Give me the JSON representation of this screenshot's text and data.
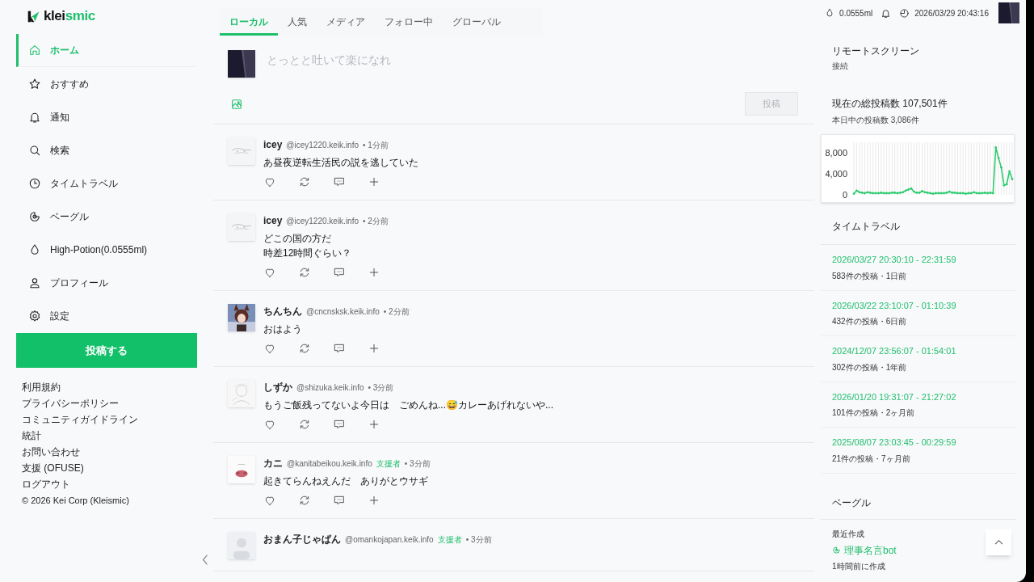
{
  "brand": {
    "prefix": "klei",
    "suffix": "smic"
  },
  "nav": [
    {
      "label": "ホーム",
      "selected": true
    },
    {
      "label": "おすすめ",
      "selected": false
    },
    {
      "label": "通知",
      "selected": false
    },
    {
      "label": "検索",
      "selected": false
    },
    {
      "label": "タイムトラベル",
      "selected": false
    },
    {
      "label": "ベーグル",
      "selected": false
    },
    {
      "label": "High-Potion(0.0555ml)",
      "selected": false
    },
    {
      "label": "プロフィール",
      "selected": false
    },
    {
      "label": "設定",
      "selected": false
    }
  ],
  "post_button": "投稿する",
  "footer_links": [
    "利用規約",
    "プライバシーポリシー",
    "コミュニティガイドライン",
    "統計",
    "お問い合わせ",
    "支援 (OFUSE)",
    "ログアウト"
  ],
  "copyright": "© 2026 Kei Corp (Kleismic)",
  "tabs": [
    {
      "label": "ローカル",
      "selected": true
    },
    {
      "label": "人気",
      "selected": false
    },
    {
      "label": "メディア",
      "selected": false
    },
    {
      "label": "フォロー中",
      "selected": false
    },
    {
      "label": "グローバル",
      "selected": false
    }
  ],
  "compose": {
    "placeholder": "とっとと吐いて楽になれ",
    "button": {
      "label": "投稿",
      "disabled": true
    }
  },
  "posts": [
    {
      "name": "icey",
      "handle": "@icey1220.keik.info",
      "time": "• 1分前",
      "lines": [
        "あ昼夜逆転生活民の説を逃していた"
      ]
    },
    {
      "name": "icey",
      "handle": "@icey1220.keik.info",
      "time": "• 2分前",
      "lines": [
        "どこの国の方だ",
        "時差12時間ぐらい？"
      ]
    },
    {
      "name": "ちんちん",
      "handle": "@cncnsksk.keik.info",
      "time": "• 2分前",
      "lines": [
        "おはよう"
      ]
    },
    {
      "name": "しずか",
      "handle": "@shizuka.keik.info",
      "time": "• 3分前",
      "lines": [
        "もうご飯残ってないよ今日は　ごめんね...😅カレーあげれないや..."
      ]
    },
    {
      "name": "カニ",
      "handle": "@kanitabeikou.keik.info",
      "badge": "支援者",
      "time": "• 3分前",
      "lines": [
        "起きてらんねえんだ　ありがとウサギ"
      ]
    },
    {
      "name": "おまん子じゃぱん",
      "handle": "@omankojapan.keik.info",
      "badge": "支援者",
      "time": "• 3分前"
    }
  ],
  "header": {
    "potion": "0.0555ml",
    "datetime": "2026/03/29 20:43:16"
  },
  "remote_screen": {
    "title": "リモートスクリーン",
    "status": "接続"
  },
  "stats": {
    "total": "現在の総投稿数 107,501件",
    "today": "本日中の投稿数 3,086件",
    "chart_data": {
      "type": "line",
      "grid": true,
      "ylim": [
        0,
        10000
      ],
      "yticks": [
        {
          "value": 0,
          "label": "0"
        },
        {
          "value": 4000,
          "label": "4,000"
        },
        {
          "value": 8000,
          "label": "8,000"
        }
      ],
      "series": [
        {
          "color": "#2ecc71",
          "values": [
            200,
            800,
            500,
            400,
            300,
            500,
            400,
            300,
            300,
            300,
            400,
            300,
            300,
            300,
            400,
            400,
            300,
            400,
            500,
            800,
            1000,
            1200,
            600,
            400,
            400,
            700,
            500,
            400,
            300,
            200,
            300,
            300,
            300,
            300,
            400,
            600,
            400,
            400,
            300,
            300,
            300,
            200,
            300,
            300,
            500,
            300,
            300,
            300,
            400,
            300,
            400,
            300,
            9000,
            7000,
            5200,
            1800,
            2000,
            4500,
            3000
          ]
        }
      ]
    }
  },
  "time_travel": {
    "title": "タイムトラベル",
    "items": [
      {
        "range": "2026/03/27 20:30:10 - 22:31:59",
        "info": "583件の投稿・1日前"
      },
      {
        "range": "2026/03/22 23:10:07 - 01:10:39",
        "info": "432件の投稿・6日前"
      },
      {
        "range": "2024/12/07 23:56:07 - 01:54:01",
        "info": "302件の投稿・1年前"
      },
      {
        "range": "2026/01/20 19:31:07 - 21:27:02",
        "info": "101件の投稿・2ヶ月前"
      },
      {
        "range": "2025/08/07 23:03:45 - 00:29:59",
        "info": "21件の投稿・7ヶ月前"
      }
    ]
  },
  "bagel": {
    "title": "ベーグル",
    "subtitle": "最近作成",
    "item": "理事名言bot",
    "created": "1時間前に作成"
  }
}
